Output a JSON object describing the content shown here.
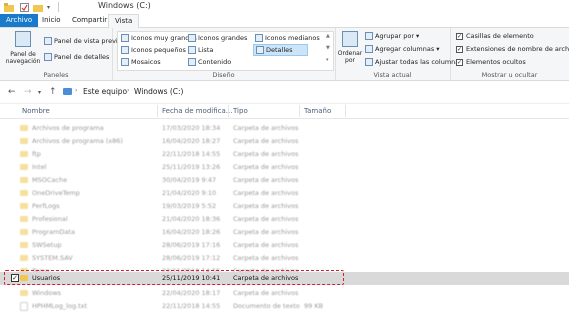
{
  "window": {
    "title": "Windows (C:)"
  },
  "tabs": [
    {
      "label": "Archivo"
    },
    {
      "label": "Inicio"
    },
    {
      "label": "Compartir"
    },
    {
      "label": "Vista"
    }
  ],
  "ribbon": {
    "panels": {
      "label": "Paneles",
      "nav_pane": "Panel de navegación",
      "preview_pane": "Panel de vista previa",
      "details_pane": "Panel de detalles"
    },
    "layout": {
      "label": "Diseño",
      "items": [
        "Iconos muy grandes",
        "Iconos grandes",
        "Iconos medianos",
        "Iconos pequeños",
        "Lista",
        "Detalles",
        "Mosaicos",
        "Contenido"
      ],
      "selected": "Detalles"
    },
    "current_view": {
      "label": "Vista actual",
      "sort_by": "Ordenar por",
      "group_by": "Agrupar por",
      "add_columns": "Agregar columnas",
      "fit_columns": "Ajustar todas las columnas"
    },
    "show_hide": {
      "label": "Mostrar u ocultar",
      "item_checkboxes": "Casillas de elemento",
      "file_extensions": "Extensiones de nombre de archivo",
      "hidden_items": "Elementos ocultos"
    }
  },
  "address": {
    "crumbs": [
      "Este equipo",
      "Windows (C:)"
    ]
  },
  "columns": {
    "name": "Nombre",
    "date": "Fecha de modifica...",
    "type": "Tipo",
    "size": "Tamaño"
  },
  "files": [
    {
      "name": "Archivos de programa",
      "date": "17/03/2020 18:34",
      "type": "Carpeta de archivos",
      "size": ""
    },
    {
      "name": "Archivos de programa (x86)",
      "date": "16/04/2020 18:27",
      "type": "Carpeta de archivos",
      "size": ""
    },
    {
      "name": "ftp",
      "date": "22/11/2018 14:55",
      "type": "Carpeta de archivos",
      "size": ""
    },
    {
      "name": "Intel",
      "date": "25/11/2019 13:26",
      "type": "Carpeta de archivos",
      "size": ""
    },
    {
      "name": "MSOCache",
      "date": "30/04/2019 9:47",
      "type": "Carpeta de archivos",
      "size": ""
    },
    {
      "name": "OneDriveTemp",
      "date": "21/04/2020 9:10",
      "type": "Carpeta de archivos",
      "size": ""
    },
    {
      "name": "PerfLogs",
      "date": "19/03/2019 5:52",
      "type": "Carpeta de archivos",
      "size": ""
    },
    {
      "name": "Profesional",
      "date": "21/04/2020 18:36",
      "type": "Carpeta de archivos",
      "size": ""
    },
    {
      "name": "ProgramData",
      "date": "16/04/2020 18:26",
      "type": "Carpeta de archivos",
      "size": ""
    },
    {
      "name": "SWSetup",
      "date": "28/06/2019 17:16",
      "type": "Carpeta de archivos",
      "size": ""
    },
    {
      "name": "SYSTEM.SAV",
      "date": "28/06/2019 17:12",
      "type": "Carpeta de archivos",
      "size": ""
    },
    {
      "name": "Temp",
      "date": "22/11/2018 14:55",
      "type": "Carpeta de archivos",
      "size": ""
    },
    {
      "name": "Usuarios",
      "date": "25/11/2019 10:41",
      "type": "Carpeta de archivos",
      "size": "",
      "selected": true
    },
    {
      "name": "Windows",
      "date": "22/04/2020 18:17",
      "type": "Carpeta de archivos",
      "size": ""
    },
    {
      "name": "HPHMLog_log.txt",
      "date": "22/11/2018 14:55",
      "type": "Documento de texto",
      "size": "99 KB"
    }
  ]
}
